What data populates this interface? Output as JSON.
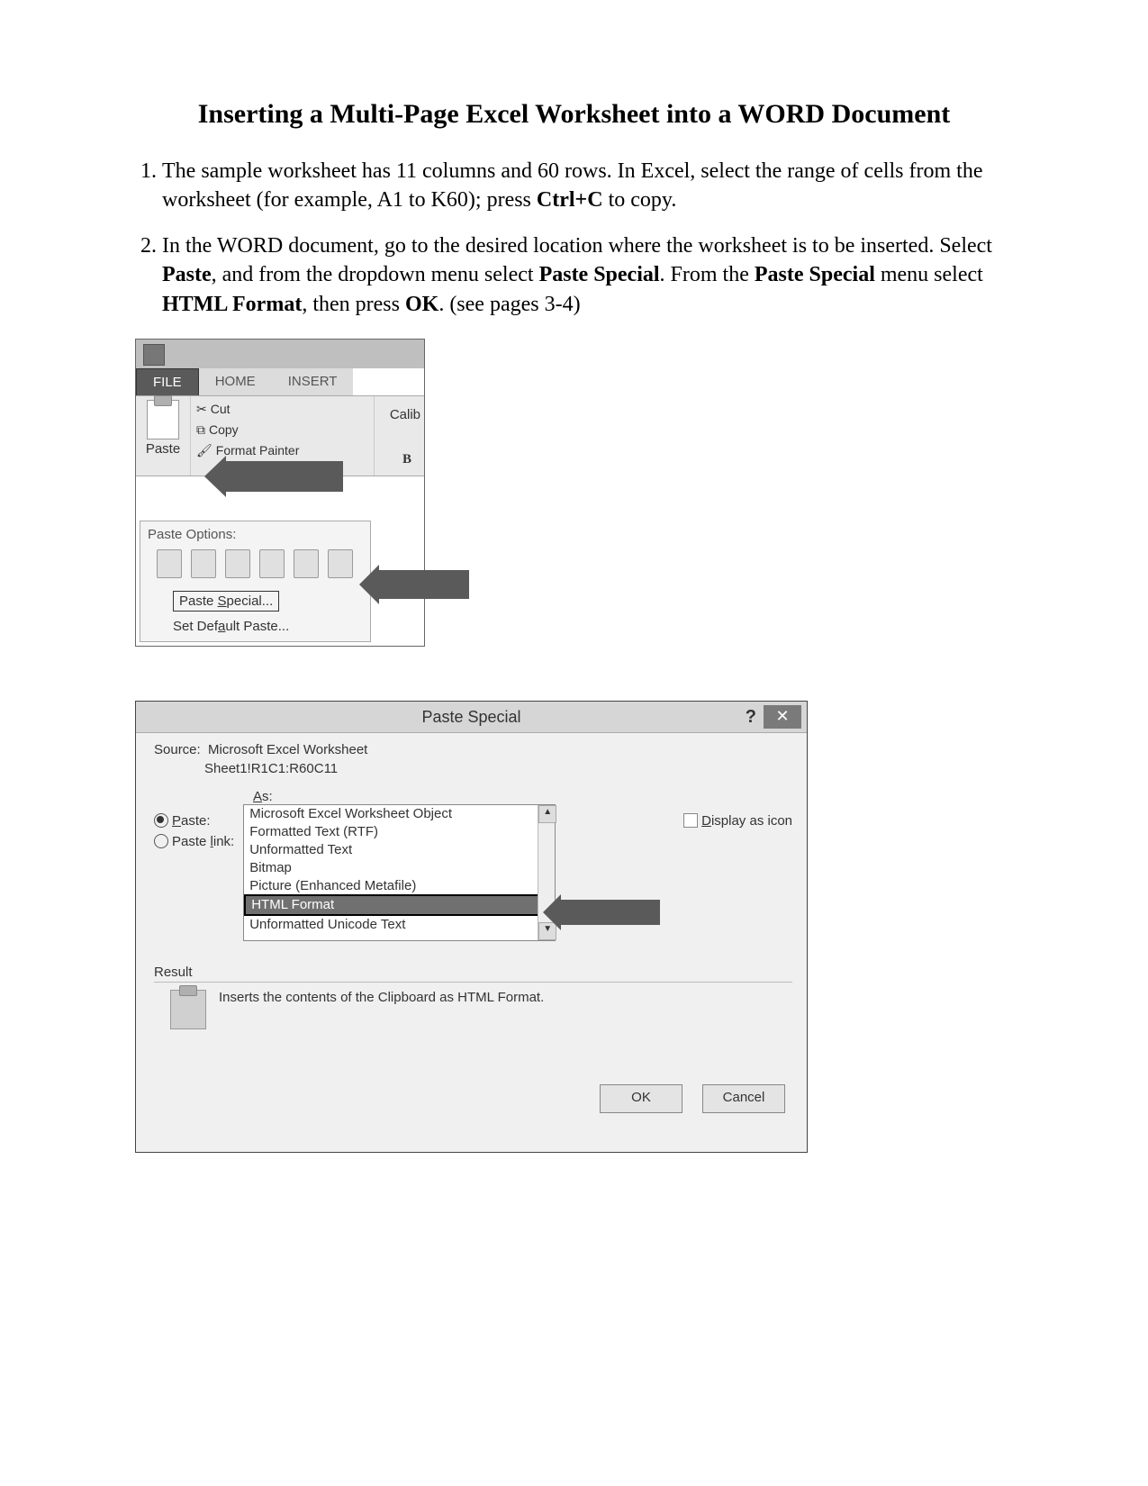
{
  "title": "Inserting a Multi-Page Excel Worksheet into a WORD Document",
  "steps": [
    {
      "pre": "The sample worksheet has 11 columns and 60 rows. In Excel, select the range of cells from the worksheet (for example, A1 to K60); press ",
      "b1": "Ctrl+C",
      "post": " to copy."
    },
    {
      "pre": "In the WORD document, go to the desired location where the worksheet is to be inserted. Select ",
      "b1": "Paste",
      "mid1": ", and from the dropdown menu select ",
      "b2": "Paste Special",
      "mid2": ". From the ",
      "b3": "Paste Special",
      "mid3": " menu select ",
      "b4": "HTML Format",
      "mid4": ", then press ",
      "b5": "OK",
      "post": ". (see pages 3-4)"
    }
  ],
  "ribbon": {
    "tabs": {
      "file": "FILE",
      "home": "HOME",
      "insert": "INSERT"
    },
    "paste_label": "Paste",
    "cut": "Cut",
    "copy": "Copy",
    "format_painter": "Format Painter",
    "font_name": "Calib",
    "bold": "B",
    "menu": {
      "header": "Paste Options:",
      "paste_special": "Paste Special...",
      "paste_special_key": "S",
      "set_default": "Set Default Paste...",
      "set_default_key": "a"
    }
  },
  "dialog": {
    "title": "Paste Special",
    "help": "?",
    "close": "✕",
    "source_label": "Source:",
    "source_value": "Microsoft Excel Worksheet",
    "source_ref": "Sheet1!R1C1:R60C11",
    "as_label": "As:",
    "paste_radio": "Paste:",
    "paste_link_radio": "Paste link:",
    "options": [
      "Microsoft Excel Worksheet Object",
      "Formatted Text (RTF)",
      "Unformatted Text",
      "Bitmap",
      "Picture (Enhanced Metafile)",
      "HTML Format",
      "Unformatted Unicode Text"
    ],
    "selected_option": "HTML Format",
    "display_as_icon": "Display as icon",
    "result_label": "Result",
    "result_text": "Inserts the contents of the Clipboard as HTML Format.",
    "ok": "OK",
    "cancel": "Cancel"
  }
}
